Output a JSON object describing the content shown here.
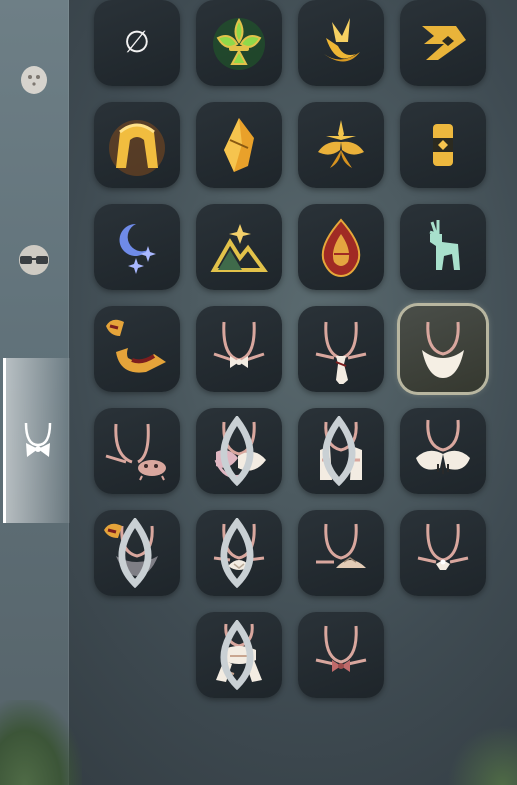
{
  "sidebar": {
    "items": [
      {
        "name": "mask-category",
        "icon": "mask-icon"
      },
      {
        "name": "glasses-category",
        "icon": "glasses-icon"
      },
      {
        "name": "necklace-category",
        "icon": "necklace-bow-icon",
        "active": true
      }
    ]
  },
  "grid": {
    "selected_index": 15,
    "items": [
      {
        "icon": "none-icon",
        "label": "∅"
      },
      {
        "icon": "green-fleur-icon"
      },
      {
        "icon": "gold-bird-icon"
      },
      {
        "icon": "gold-arrow-icon"
      },
      {
        "icon": "gold-arch-icon"
      },
      {
        "icon": "gold-crystal-icon"
      },
      {
        "icon": "gold-wings-icon"
      },
      {
        "icon": "gold-lantern-icon"
      },
      {
        "icon": "blue-moon-icon"
      },
      {
        "icon": "gold-mountain-icon"
      },
      {
        "icon": "red-flame-icon"
      },
      {
        "icon": "teal-deer-icon"
      },
      {
        "icon": "red-horn-icon"
      },
      {
        "icon": "necklace-bow-icon"
      },
      {
        "icon": "necklace-tie-icon"
      },
      {
        "icon": "necklace-bib-icon"
      },
      {
        "icon": "necklace-crab-icon"
      },
      {
        "icon": "necklace-flower-icon",
        "droplet": true
      },
      {
        "icon": "necklace-cape-icon",
        "droplet": true
      },
      {
        "icon": "necklace-wing-collar-icon"
      },
      {
        "icon": "necklace-horn-bib-icon",
        "droplet": true
      },
      {
        "icon": "necklace-shell-icon",
        "droplet": true
      },
      {
        "icon": "necklace-turtle-icon"
      },
      {
        "icon": "necklace-pearl-icon"
      },
      {
        "icon": "necklace-scarf-icon",
        "droplet": true
      },
      {
        "icon": "necklace-red-bow-icon"
      }
    ]
  },
  "colors": {
    "cord": "#d9a79e",
    "gold": "#e6b83a",
    "selected_border": "#b8b6a0"
  }
}
